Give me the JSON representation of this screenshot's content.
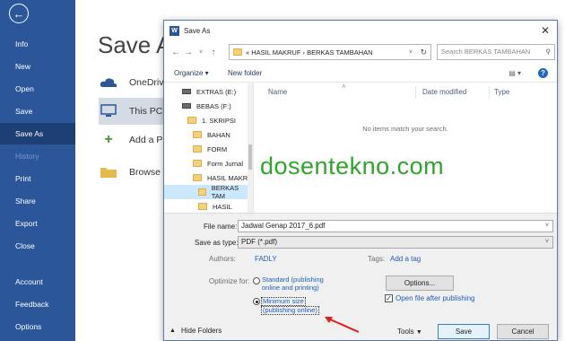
{
  "backstage": {
    "items": [
      {
        "label": "Info",
        "state": "normal"
      },
      {
        "label": "New",
        "state": "normal"
      },
      {
        "label": "Open",
        "state": "normal"
      },
      {
        "label": "Save",
        "state": "normal"
      },
      {
        "label": "Save As",
        "state": "active"
      },
      {
        "label": "History",
        "state": "disabled"
      },
      {
        "label": "Print",
        "state": "normal"
      },
      {
        "label": "Share",
        "state": "normal"
      },
      {
        "label": "Export",
        "state": "normal"
      },
      {
        "label": "Close",
        "state": "normal"
      },
      {
        "label": "Account",
        "state": "normal"
      },
      {
        "label": "Feedback",
        "state": "normal"
      },
      {
        "label": "Options",
        "state": "normal"
      }
    ],
    "title": "Save A",
    "locations": [
      {
        "label": "OneDriv",
        "icon": "cloud-icon"
      },
      {
        "label": "This PC",
        "icon": "computer-icon"
      },
      {
        "label": "Add a P",
        "icon": "plus-icon"
      },
      {
        "label": "Browse",
        "icon": "folder-icon"
      }
    ]
  },
  "dialog": {
    "title": "Save As",
    "close_glyph": "✕",
    "path": "« HASIL MAKRUF  ›  BERKAS TAMBAHAN",
    "search_placeholder": "Search BERKAS TAMBAHAN",
    "organize_label": "Organize ▾",
    "new_folder_label": "New folder",
    "help_glyph": "?",
    "tree": [
      {
        "label": "EXTRAS (E:)",
        "type": "drive"
      },
      {
        "label": "BEBAS (F:)",
        "type": "drive"
      },
      {
        "label": "1. SKRIPSI",
        "type": "folder"
      },
      {
        "label": "BAHAN",
        "type": "folder"
      },
      {
        "label": "FORM",
        "type": "folder"
      },
      {
        "label": "Form Jurnal",
        "type": "folder"
      },
      {
        "label": "HASIL MAKRU",
        "type": "folder"
      },
      {
        "label": "BERKAS TAM",
        "type": "folder"
      },
      {
        "label": "HASIL",
        "type": "folder"
      }
    ],
    "columns": {
      "name": "Name",
      "date": "Date modified",
      "type": "Type"
    },
    "empty_message": "No items match your search.",
    "file_name_label": "File name:",
    "file_name_value": "Jadwal Genap 2017_6.pdf",
    "save_type_label": "Save as type:",
    "save_type_value": "PDF (*.pdf)",
    "authors_label": "Authors:",
    "authors_value": "FADLY",
    "tags_label": "Tags:",
    "tags_value": "Add a tag",
    "optimize_label": "Optimize for:",
    "opt_standard_1": "Standard (publishing",
    "opt_standard_2": "online and printing)",
    "opt_min_1": "Minimum size",
    "opt_min_2": "(publishing online)",
    "options_button": "Options...",
    "open_after_label": "Open file after publishing",
    "hide_folders_label": "Hide Folders",
    "tools_label": "Tools",
    "save_button": "Save",
    "cancel_button": "Cancel"
  },
  "watermark": "dosentekno.com",
  "colors": {
    "backstage": "#2b579a",
    "active": "#1e3f73",
    "watermark": "#2ea52a",
    "arrow": "#e21b1b"
  }
}
